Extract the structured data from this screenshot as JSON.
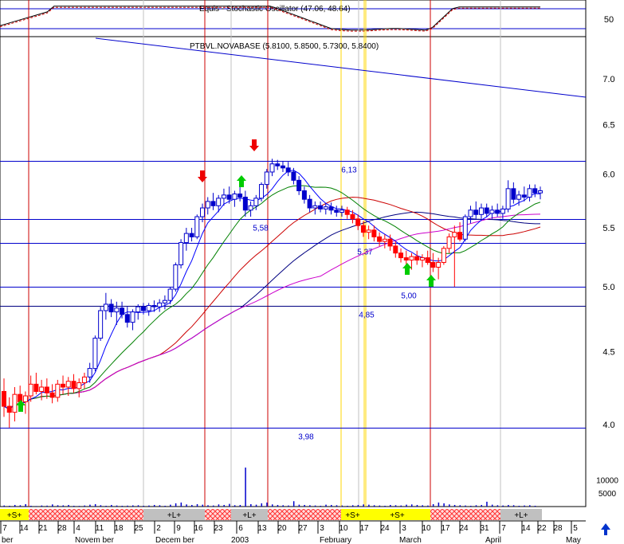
{
  "chart_data": {
    "type": "candlestick",
    "instrument_label": "PTBVL.NOVABASE (5.8100, 5.8500, 5.7300, 5.8400)",
    "oscillator_label": "Equis - Stochastic Oscillator (47.06, 48.64)",
    "oscillator_levels": [
      "50"
    ],
    "oscillator_ylim": [
      0,
      100
    ],
    "price_axis": {
      "scale": "log",
      "ylim": [
        3.85,
        7.45
      ],
      "ticks": [
        "7.0",
        "6.5",
        "6.0",
        "5.5",
        "5.0",
        "4.5",
        "4.0"
      ]
    },
    "volume_axis": {
      "ylim": [
        0,
        16000
      ],
      "ticks": [
        "10000",
        "5000"
      ]
    },
    "levels": [
      {
        "value": 6.13,
        "label": "6,13"
      },
      {
        "value": 5.58,
        "label": "5,58"
      },
      {
        "value": 5.37,
        "label": "5,37"
      },
      {
        "value": 5.0,
        "label": "5,00"
      },
      {
        "value": 4.85,
        "label": "4,85"
      },
      {
        "value": 3.98,
        "label": "3,98"
      }
    ],
    "x_day_labels": [
      "7",
      "14",
      "21",
      "28",
      "4",
      "11",
      "18",
      "25",
      "2",
      "9",
      "16",
      "23",
      "6",
      "13",
      "20",
      "27",
      "3",
      "10",
      "17",
      "24",
      "3",
      "10",
      "17",
      "24",
      "31",
      "7",
      "14",
      "22",
      "28",
      "5"
    ],
    "x_month_labels": [
      "ber",
      "Novem ber",
      "Decem ber",
      "2003",
      "February",
      "March",
      "April",
      "May"
    ],
    "signal_bar": [
      {
        "label": "+S+"
      },
      {
        "label": ""
      },
      {
        "label": "+L+"
      },
      {
        "label": "+L+"
      },
      {
        "label": "+S+"
      },
      {
        "label": "+S+"
      },
      {
        "label": ""
      },
      {
        "label": "+L+"
      }
    ],
    "series": [
      {
        "type": "moving-average",
        "color": "#000080"
      },
      {
        "type": "moving-average",
        "color": "#cc0000"
      },
      {
        "type": "moving-average",
        "color": "#cc00cc"
      },
      {
        "type": "moving-average",
        "color": "#008000"
      },
      {
        "type": "moving-average",
        "color": "#0000ff"
      },
      {
        "type": "trendline",
        "color": "#0000cc"
      }
    ],
    "candles": [
      {
        "o": 4.22,
        "h": 4.31,
        "l": 4.05,
        "c": 4.12
      },
      {
        "o": 4.12,
        "h": 4.18,
        "l": 3.98,
        "c": 4.08
      },
      {
        "o": 4.08,
        "h": 4.25,
        "l": 4.02,
        "c": 4.2
      },
      {
        "o": 4.2,
        "h": 4.26,
        "l": 4.1,
        "c": 4.15
      },
      {
        "o": 4.15,
        "h": 4.22,
        "l": 4.07,
        "c": 4.19
      },
      {
        "o": 4.19,
        "h": 4.33,
        "l": 4.15,
        "c": 4.27
      },
      {
        "o": 4.27,
        "h": 4.35,
        "l": 4.2,
        "c": 4.22
      },
      {
        "o": 4.22,
        "h": 4.3,
        "l": 4.16,
        "c": 4.25
      },
      {
        "o": 4.25,
        "h": 4.31,
        "l": 4.17,
        "c": 4.21
      },
      {
        "o": 4.21,
        "h": 4.27,
        "l": 4.14,
        "c": 4.18
      },
      {
        "o": 4.18,
        "h": 4.3,
        "l": 4.15,
        "c": 4.27
      },
      {
        "o": 4.27,
        "h": 4.33,
        "l": 4.2,
        "c": 4.25
      },
      {
        "o": 4.25,
        "h": 4.32,
        "l": 4.19,
        "c": 4.29
      },
      {
        "o": 4.29,
        "h": 4.34,
        "l": 4.21,
        "c": 4.24
      },
      {
        "o": 4.24,
        "h": 4.31,
        "l": 4.18,
        "c": 4.28
      },
      {
        "o": 4.28,
        "h": 4.35,
        "l": 4.24,
        "c": 4.32
      },
      {
        "o": 4.32,
        "h": 4.42,
        "l": 4.28,
        "c": 4.38
      },
      {
        "o": 4.38,
        "h": 4.62,
        "l": 4.36,
        "c": 4.6
      },
      {
        "o": 4.6,
        "h": 4.84,
        "l": 4.58,
        "c": 4.81
      },
      {
        "o": 4.81,
        "h": 4.95,
        "l": 4.74,
        "c": 4.86
      },
      {
        "o": 4.86,
        "h": 4.9,
        "l": 4.76,
        "c": 4.8
      },
      {
        "o": 4.8,
        "h": 4.88,
        "l": 4.7,
        "c": 4.83
      },
      {
        "o": 4.83,
        "h": 4.88,
        "l": 4.75,
        "c": 4.78
      },
      {
        "o": 4.78,
        "h": 4.84,
        "l": 4.68,
        "c": 4.72
      },
      {
        "o": 4.72,
        "h": 4.82,
        "l": 4.66,
        "c": 4.8
      },
      {
        "o": 4.8,
        "h": 4.86,
        "l": 4.74,
        "c": 4.84
      },
      {
        "o": 4.84,
        "h": 4.87,
        "l": 4.78,
        "c": 4.81
      },
      {
        "o": 4.81,
        "h": 4.87,
        "l": 4.77,
        "c": 4.85
      },
      {
        "o": 4.85,
        "h": 4.89,
        "l": 4.8,
        "c": 4.84
      },
      {
        "o": 4.84,
        "h": 4.9,
        "l": 4.8,
        "c": 4.87
      },
      {
        "o": 4.87,
        "h": 4.93,
        "l": 4.82,
        "c": 4.89
      },
      {
        "o": 4.89,
        "h": 5.0,
        "l": 4.86,
        "c": 4.98
      },
      {
        "o": 4.98,
        "h": 5.2,
        "l": 4.96,
        "c": 5.18
      },
      {
        "o": 5.18,
        "h": 5.4,
        "l": 5.15,
        "c": 5.37
      },
      {
        "o": 5.37,
        "h": 5.5,
        "l": 5.3,
        "c": 5.45
      },
      {
        "o": 5.45,
        "h": 5.5,
        "l": 5.38,
        "c": 5.42
      },
      {
        "o": 5.42,
        "h": 5.62,
        "l": 5.4,
        "c": 5.6
      },
      {
        "o": 5.6,
        "h": 5.72,
        "l": 5.55,
        "c": 5.68
      },
      {
        "o": 5.68,
        "h": 5.78,
        "l": 5.62,
        "c": 5.74
      },
      {
        "o": 5.74,
        "h": 5.82,
        "l": 5.66,
        "c": 5.7
      },
      {
        "o": 5.7,
        "h": 5.8,
        "l": 5.64,
        "c": 5.77
      },
      {
        "o": 5.77,
        "h": 5.86,
        "l": 5.7,
        "c": 5.8
      },
      {
        "o": 5.8,
        "h": 5.88,
        "l": 5.72,
        "c": 5.76
      },
      {
        "o": 5.76,
        "h": 5.84,
        "l": 5.69,
        "c": 5.81
      },
      {
        "o": 5.81,
        "h": 5.88,
        "l": 5.74,
        "c": 5.78
      },
      {
        "o": 5.78,
        "h": 5.84,
        "l": 5.6,
        "c": 5.66
      },
      {
        "o": 5.66,
        "h": 5.74,
        "l": 5.6,
        "c": 5.7
      },
      {
        "o": 5.7,
        "h": 5.8,
        "l": 5.66,
        "c": 5.77
      },
      {
        "o": 5.77,
        "h": 5.92,
        "l": 5.74,
        "c": 5.9
      },
      {
        "o": 5.9,
        "h": 6.05,
        "l": 5.86,
        "c": 6.02
      },
      {
        "o": 6.02,
        "h": 6.15,
        "l": 5.98,
        "c": 6.1
      },
      {
        "o": 6.1,
        "h": 6.14,
        "l": 6.04,
        "c": 6.08
      },
      {
        "o": 6.08,
        "h": 6.13,
        "l": 6.02,
        "c": 6.06
      },
      {
        "o": 6.06,
        "h": 6.12,
        "l": 5.98,
        "c": 6.02
      },
      {
        "o": 6.02,
        "h": 6.06,
        "l": 5.9,
        "c": 5.94
      },
      {
        "o": 5.94,
        "h": 5.98,
        "l": 5.8,
        "c": 5.84
      },
      {
        "o": 5.84,
        "h": 5.88,
        "l": 5.72,
        "c": 5.76
      },
      {
        "o": 5.76,
        "h": 5.8,
        "l": 5.64,
        "c": 5.68
      },
      {
        "o": 5.68,
        "h": 5.74,
        "l": 5.62,
        "c": 5.7
      },
      {
        "o": 5.7,
        "h": 5.74,
        "l": 5.64,
        "c": 5.67
      },
      {
        "o": 5.67,
        "h": 5.72,
        "l": 5.62,
        "c": 5.69
      },
      {
        "o": 5.69,
        "h": 5.73,
        "l": 5.62,
        "c": 5.66
      },
      {
        "o": 5.66,
        "h": 5.7,
        "l": 5.6,
        "c": 5.64
      },
      {
        "o": 5.64,
        "h": 5.7,
        "l": 5.6,
        "c": 5.66
      },
      {
        "o": 5.66,
        "h": 5.69,
        "l": 5.58,
        "c": 5.62
      },
      {
        "o": 5.62,
        "h": 5.66,
        "l": 5.54,
        "c": 5.58
      },
      {
        "o": 5.58,
        "h": 5.62,
        "l": 5.48,
        "c": 5.52
      },
      {
        "o": 5.52,
        "h": 5.56,
        "l": 5.42,
        "c": 5.46
      },
      {
        "o": 5.46,
        "h": 5.52,
        "l": 5.4,
        "c": 5.48
      },
      {
        "o": 5.48,
        "h": 5.52,
        "l": 5.38,
        "c": 5.42
      },
      {
        "o": 5.42,
        "h": 5.46,
        "l": 5.34,
        "c": 5.38
      },
      {
        "o": 5.38,
        "h": 5.44,
        "l": 5.32,
        "c": 5.4
      },
      {
        "o": 5.4,
        "h": 5.44,
        "l": 5.3,
        "c": 5.34
      },
      {
        "o": 5.34,
        "h": 5.38,
        "l": 5.24,
        "c": 5.28
      },
      {
        "o": 5.28,
        "h": 5.32,
        "l": 5.2,
        "c": 5.24
      },
      {
        "o": 5.24,
        "h": 5.3,
        "l": 5.1,
        "c": 5.22
      },
      {
        "o": 5.22,
        "h": 5.28,
        "l": 5.14,
        "c": 5.25
      },
      {
        "o": 5.25,
        "h": 5.3,
        "l": 5.18,
        "c": 5.22
      },
      {
        "o": 5.22,
        "h": 5.27,
        "l": 5.16,
        "c": 5.24
      },
      {
        "o": 5.24,
        "h": 5.3,
        "l": 5.18,
        "c": 5.2
      },
      {
        "o": 5.2,
        "h": 5.28,
        "l": 5.12,
        "c": 5.16
      },
      {
        "o": 5.16,
        "h": 5.24,
        "l": 5.06,
        "c": 5.2
      },
      {
        "o": 5.2,
        "h": 5.34,
        "l": 5.18,
        "c": 5.32
      },
      {
        "o": 5.32,
        "h": 5.45,
        "l": 5.28,
        "c": 5.42
      },
      {
        "o": 5.42,
        "h": 5.52,
        "l": 5.0,
        "c": 5.46
      },
      {
        "o": 5.46,
        "h": 5.55,
        "l": 5.38,
        "c": 5.4
      },
      {
        "o": 5.4,
        "h": 5.62,
        "l": 5.38,
        "c": 5.6
      },
      {
        "o": 5.6,
        "h": 5.7,
        "l": 5.54,
        "c": 5.66
      },
      {
        "o": 5.66,
        "h": 5.74,
        "l": 5.58,
        "c": 5.62
      },
      {
        "o": 5.62,
        "h": 5.72,
        "l": 5.58,
        "c": 5.68
      },
      {
        "o": 5.68,
        "h": 5.72,
        "l": 5.6,
        "c": 5.63
      },
      {
        "o": 5.63,
        "h": 5.7,
        "l": 5.58,
        "c": 5.66
      },
      {
        "o": 5.66,
        "h": 5.72,
        "l": 5.6,
        "c": 5.63
      },
      {
        "o": 5.63,
        "h": 5.7,
        "l": 5.58,
        "c": 5.67
      },
      {
        "o": 5.67,
        "h": 5.94,
        "l": 5.64,
        "c": 5.86
      },
      {
        "o": 5.86,
        "h": 5.92,
        "l": 5.72,
        "c": 5.76
      },
      {
        "o": 5.76,
        "h": 5.84,
        "l": 5.7,
        "c": 5.8
      },
      {
        "o": 5.8,
        "h": 5.88,
        "l": 5.74,
        "c": 5.78
      },
      {
        "o": 5.78,
        "h": 5.9,
        "l": 5.74,
        "c": 5.86
      },
      {
        "o": 5.86,
        "h": 5.9,
        "l": 5.78,
        "c": 5.82
      },
      {
        "o": 5.82,
        "h": 5.88,
        "l": 5.76,
        "c": 5.84
      }
    ],
    "volume": [
      400,
      300,
      600,
      500,
      900,
      300,
      200,
      400,
      350,
      800,
      500,
      450,
      600,
      300,
      250,
      400,
      700,
      900,
      500,
      300,
      600,
      400,
      300,
      350,
      450,
      500,
      300,
      400,
      600,
      500,
      300,
      700,
      1200,
      1500,
      800,
      600,
      900,
      700,
      500,
      400,
      800,
      600,
      1000,
      500,
      600,
      14500,
      900,
      700,
      1200,
      1500,
      800,
      600,
      500,
      400,
      2000,
      700,
      600,
      500,
      400,
      300,
      700,
      600,
      500,
      400,
      300,
      500,
      600,
      800,
      700,
      500,
      400,
      300,
      600,
      500,
      400,
      700,
      800,
      600,
      500,
      400,
      900,
      1500,
      1200,
      800,
      600,
      500,
      400,
      300,
      500,
      600,
      1800,
      700,
      500,
      400,
      600,
      500,
      300,
      400,
      500,
      300
    ]
  }
}
